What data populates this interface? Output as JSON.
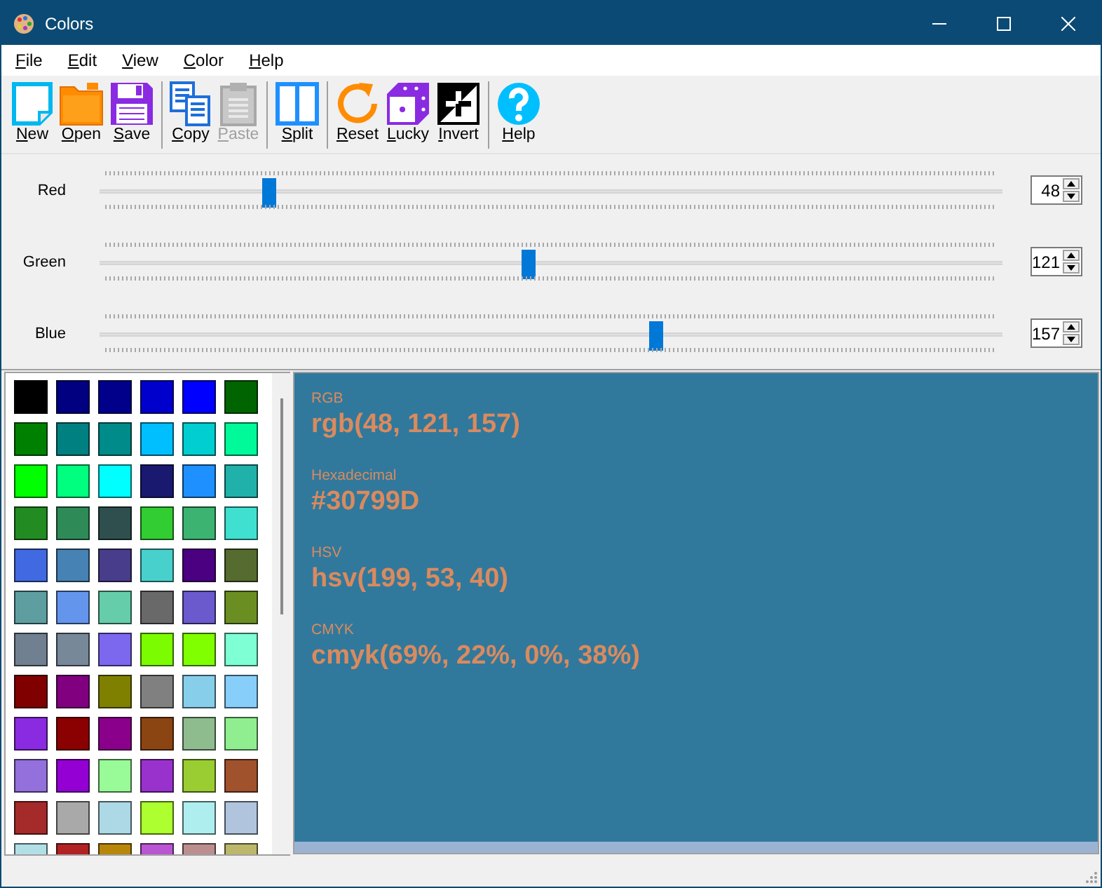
{
  "window": {
    "title": "Colors"
  },
  "menu": [
    {
      "label": "File"
    },
    {
      "label": "Edit"
    },
    {
      "label": "View"
    },
    {
      "label": "Color"
    },
    {
      "label": "Help"
    }
  ],
  "toolbar": [
    {
      "buttons": [
        {
          "label": "New",
          "disabled": false
        },
        {
          "label": "Open",
          "disabled": false
        },
        {
          "label": "Save",
          "disabled": false
        }
      ]
    },
    {
      "buttons": [
        {
          "label": "Copy",
          "disabled": false
        },
        {
          "label": "Paste",
          "disabled": true
        }
      ]
    },
    {
      "buttons": [
        {
          "label": "Split",
          "disabled": false
        }
      ]
    },
    {
      "buttons": [
        {
          "label": "Reset",
          "disabled": false
        },
        {
          "label": "Lucky",
          "disabled": false
        },
        {
          "label": "Invert",
          "disabled": false
        }
      ]
    },
    {
      "buttons": [
        {
          "label": "Help",
          "disabled": false
        }
      ]
    }
  ],
  "sliders": [
    {
      "label": "Red",
      "level": 0.188,
      "value": "48"
    },
    {
      "label": "Green",
      "level": 0.475,
      "value": "121"
    },
    {
      "label": "Blue",
      "level": 0.616,
      "value": "157"
    }
  ],
  "palette": [
    {
      "color": "#000000"
    },
    {
      "color": "#000080"
    },
    {
      "color": "#00008b"
    },
    {
      "color": "#0000cd"
    },
    {
      "color": "#0000ff"
    },
    {
      "color": "#006400"
    },
    {
      "color": "#008000"
    },
    {
      "color": "#008080"
    },
    {
      "color": "#008b8b"
    },
    {
      "color": "#00bfff"
    },
    {
      "color": "#00ced1"
    },
    {
      "color": "#00fa9a"
    },
    {
      "color": "#00ff00"
    },
    {
      "color": "#00ff7f"
    },
    {
      "color": "#00ffff"
    },
    {
      "color": "#191970"
    },
    {
      "color": "#1e90ff"
    },
    {
      "color": "#20b2aa"
    },
    {
      "color": "#228b22"
    },
    {
      "color": "#2e8b57"
    },
    {
      "color": "#2f4f4f"
    },
    {
      "color": "#32cd32"
    },
    {
      "color": "#3cb371"
    },
    {
      "color": "#40e0d0"
    },
    {
      "color": "#4169e1"
    },
    {
      "color": "#4682b4"
    },
    {
      "color": "#483d8b"
    },
    {
      "color": "#48d1cc"
    },
    {
      "color": "#4b0082"
    },
    {
      "color": "#556b2f"
    },
    {
      "color": "#5f9ea0"
    },
    {
      "color": "#6495ed"
    },
    {
      "color": "#66cdaa"
    },
    {
      "color": "#696969"
    },
    {
      "color": "#6a5acd"
    },
    {
      "color": "#6b8e23"
    },
    {
      "color": "#708090"
    },
    {
      "color": "#778899"
    },
    {
      "color": "#7b68ee"
    },
    {
      "color": "#7cfc00"
    },
    {
      "color": "#7fff00"
    },
    {
      "color": "#7fffd4"
    },
    {
      "color": "#800000"
    },
    {
      "color": "#800080"
    },
    {
      "color": "#808000"
    },
    {
      "color": "#808080"
    },
    {
      "color": "#87ceeb"
    },
    {
      "color": "#87cefa"
    },
    {
      "color": "#8a2be2"
    },
    {
      "color": "#8b0000"
    },
    {
      "color": "#8b008b"
    },
    {
      "color": "#8b4513"
    },
    {
      "color": "#8fbc8f"
    },
    {
      "color": "#90ee90"
    },
    {
      "color": "#9370db"
    },
    {
      "color": "#9400d3"
    },
    {
      "color": "#98fb98"
    },
    {
      "color": "#9932cc"
    },
    {
      "color": "#9acd32"
    },
    {
      "color": "#a0522d"
    },
    {
      "color": "#a52a2a"
    },
    {
      "color": "#a9a9a9"
    },
    {
      "color": "#add8e6"
    },
    {
      "color": "#adff2f"
    },
    {
      "color": "#afeeee"
    },
    {
      "color": "#b0c4de"
    },
    {
      "color": "#b0e0e6"
    },
    {
      "color": "#b22222"
    },
    {
      "color": "#b8860b"
    },
    {
      "color": "#ba55d3"
    },
    {
      "color": "#bc8f8f"
    },
    {
      "color": "#bdb76b"
    }
  ],
  "preview": {
    "color": "#30799d",
    "formats": [
      {
        "label": "RGB",
        "value": "rgb(48, 121, 157)"
      },
      {
        "label": "Hexadecimal",
        "value": "#30799D"
      },
      {
        "label": "HSV",
        "value": "hsv(199, 53, 40)"
      },
      {
        "label": "CMYK",
        "value": "cmyk(69%, 22%, 0%, 38%)"
      }
    ]
  }
}
